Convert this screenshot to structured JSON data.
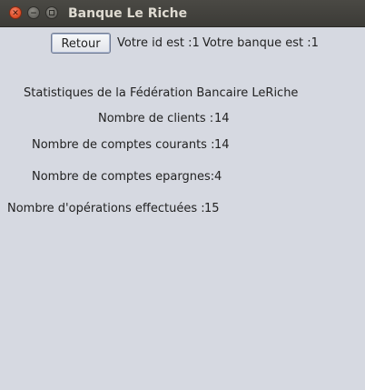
{
  "window": {
    "title": "Banque Le Riche"
  },
  "toolbar": {
    "retour_label": "Retour",
    "user_id_text": "Votre id est :1",
    "bank_text": "Votre banque est :1"
  },
  "stats": {
    "heading": "Statistiques de la Fédération Bancaire LeRiche",
    "clients_label": "Nombre de clients :",
    "clients_value": "14",
    "comptes_courants_label": "Nombre de comptes courants :",
    "comptes_courants_value": "14",
    "comptes_epargnes_label": "Nombre de comptes epargnes:",
    "comptes_epargnes_value": "4",
    "operations_label": "Nombre d'opérations effectuées :",
    "operations_value": "15"
  }
}
